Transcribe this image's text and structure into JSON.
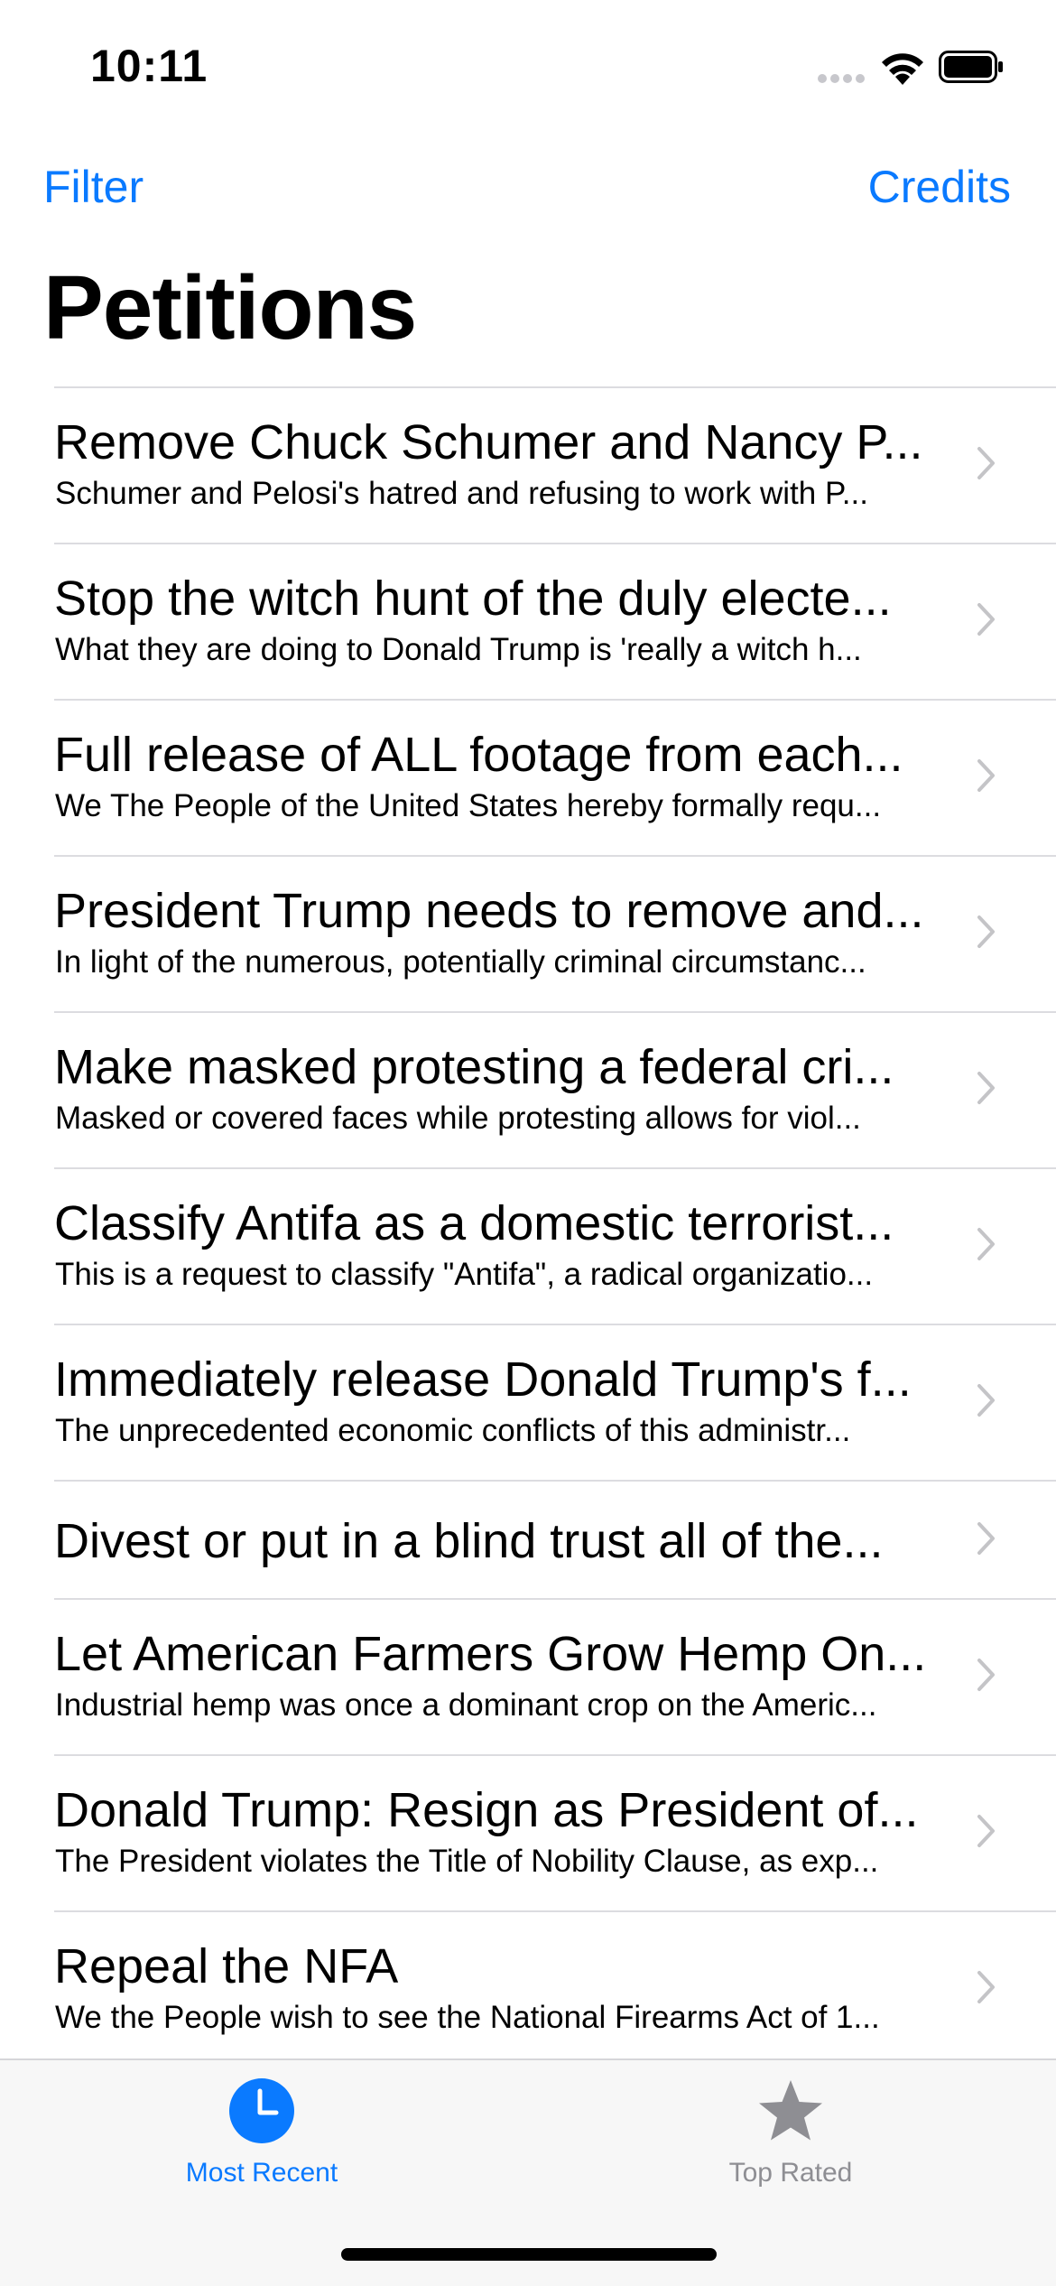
{
  "status_bar": {
    "time": "10:11"
  },
  "nav": {
    "left_button": "Filter",
    "right_button": "Credits",
    "title": "Petitions"
  },
  "petitions": [
    {
      "title": "Remove Chuck Schumer and Nancy P...",
      "body": "Schumer and Pelosi's hatred and refusing to work with P..."
    },
    {
      "title": "Stop the witch hunt of the duly electe...",
      "body": "What they are doing to Donald Trump is 'really a witch h..."
    },
    {
      "title": "Full release of ALL footage from each...",
      "body": "We The People of the United States hereby formally requ..."
    },
    {
      "title": "President Trump needs to remove and...",
      "body": "In light of the numerous, potentially criminal circumstanc..."
    },
    {
      "title": "Make masked protesting a federal cri...",
      "body": "Masked or covered faces while protesting allows for viol..."
    },
    {
      "title": "Classify Antifa as a domestic terrorist...",
      "body": "This is a request to classify \"Antifa\", a radical organizatio..."
    },
    {
      "title": "Immediately release Donald Trump's f...",
      "body": "The unprecedented economic conflicts of this administr..."
    },
    {
      "title": "Divest or put in a blind trust all of the...",
      "body": ""
    },
    {
      "title": "Let American Farmers Grow Hemp On...",
      "body": "Industrial hemp was once a dominant crop on the Americ..."
    },
    {
      "title": "Donald Trump:  Resign as President of...",
      "body": "The President violates the Title of Nobility Clause, as exp..."
    },
    {
      "title": "Repeal the NFA",
      "body": "We the People wish to see the National Firearms Act of 1..."
    }
  ],
  "tabs": [
    {
      "label": "Most Recent",
      "icon": "clock-icon",
      "selected": true
    },
    {
      "label": "Top Rated",
      "icon": "star-icon",
      "selected": false
    }
  ],
  "colors": {
    "accent": "#0a7aff",
    "inactive": "#8e8e93",
    "separator": "#dcdce0",
    "tab_bar_bg": "#f7f7f7"
  }
}
